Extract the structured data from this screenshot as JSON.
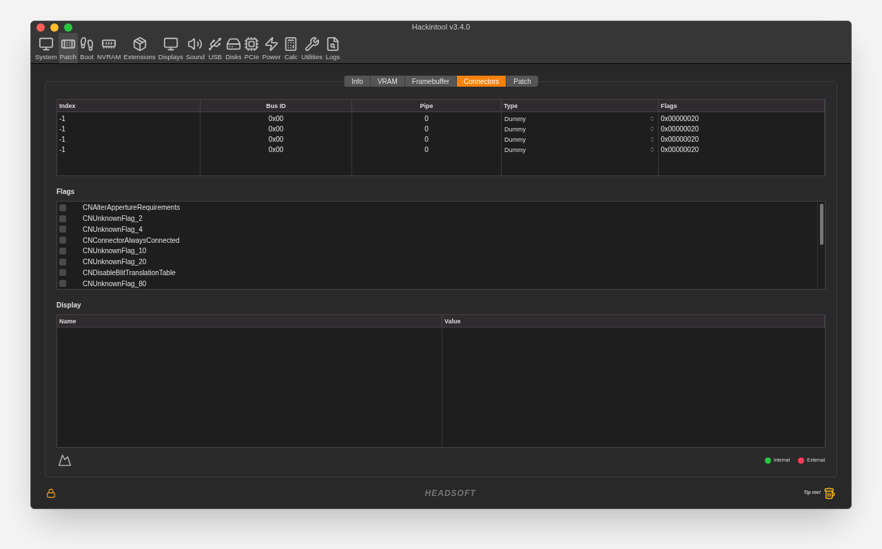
{
  "window": {
    "title": "Hackintool v3.4.0"
  },
  "toolbar": [
    {
      "label": "System",
      "selected": false
    },
    {
      "label": "Patch",
      "selected": true
    },
    {
      "label": "Boot",
      "selected": false
    },
    {
      "label": "NVRAM",
      "selected": false
    },
    {
      "label": "Extensions",
      "selected": false
    },
    {
      "label": "Displays",
      "selected": false
    },
    {
      "label": "Sound",
      "selected": false
    },
    {
      "label": "USB",
      "selected": false
    },
    {
      "label": "Disks",
      "selected": false
    },
    {
      "label": "PCIe",
      "selected": false
    },
    {
      "label": "Power",
      "selected": false
    },
    {
      "label": "Calc",
      "selected": false
    },
    {
      "label": "Utilities",
      "selected": false
    },
    {
      "label": "Logs",
      "selected": false
    }
  ],
  "tabs": [
    {
      "label": "Info",
      "selected": false
    },
    {
      "label": "VRAM",
      "selected": false
    },
    {
      "label": "Framebuffer",
      "selected": false
    },
    {
      "label": "Connectors",
      "selected": true
    },
    {
      "label": "Patch",
      "selected": false
    }
  ],
  "connectors": {
    "columns": [
      "Index",
      "Bus ID",
      "Pipe",
      "Type",
      "Flags"
    ],
    "rows": [
      [
        "-1",
        "0x00",
        "0",
        "Dummy",
        "0x00000020"
      ],
      [
        "-1",
        "0x00",
        "0",
        "Dummy",
        "0x00000020"
      ],
      [
        "-1",
        "0x00",
        "0",
        "Dummy",
        "0x00000020"
      ],
      [
        "-1",
        "0x00",
        "0",
        "Dummy",
        "0x00000020"
      ]
    ]
  },
  "flags": {
    "title": "Flags",
    "items": [
      {
        "label": "CNAlterAppertureRequirements",
        "checked": false
      },
      {
        "label": "CNUnknownFlag_2",
        "checked": false
      },
      {
        "label": "CNUnknownFlag_4",
        "checked": false
      },
      {
        "label": "CNConnectorAlwaysConnected",
        "checked": false
      },
      {
        "label": "CNUnknownFlag_10",
        "checked": false
      },
      {
        "label": "CNUnknownFlag_20",
        "checked": false
      },
      {
        "label": "CNDisableBlitTranslationTable",
        "checked": false
      },
      {
        "label": "CNUnknownFlag_80",
        "checked": false
      }
    ]
  },
  "display": {
    "title": "Display",
    "columns": [
      "Name",
      "Value"
    ]
  },
  "legend": [
    {
      "label": "Internal",
      "color": "#28c840"
    },
    {
      "label": "External",
      "color": "#ff3b5c"
    }
  ],
  "footer": {
    "logo": "HEADSOFT",
    "tip": "Tip me!"
  }
}
